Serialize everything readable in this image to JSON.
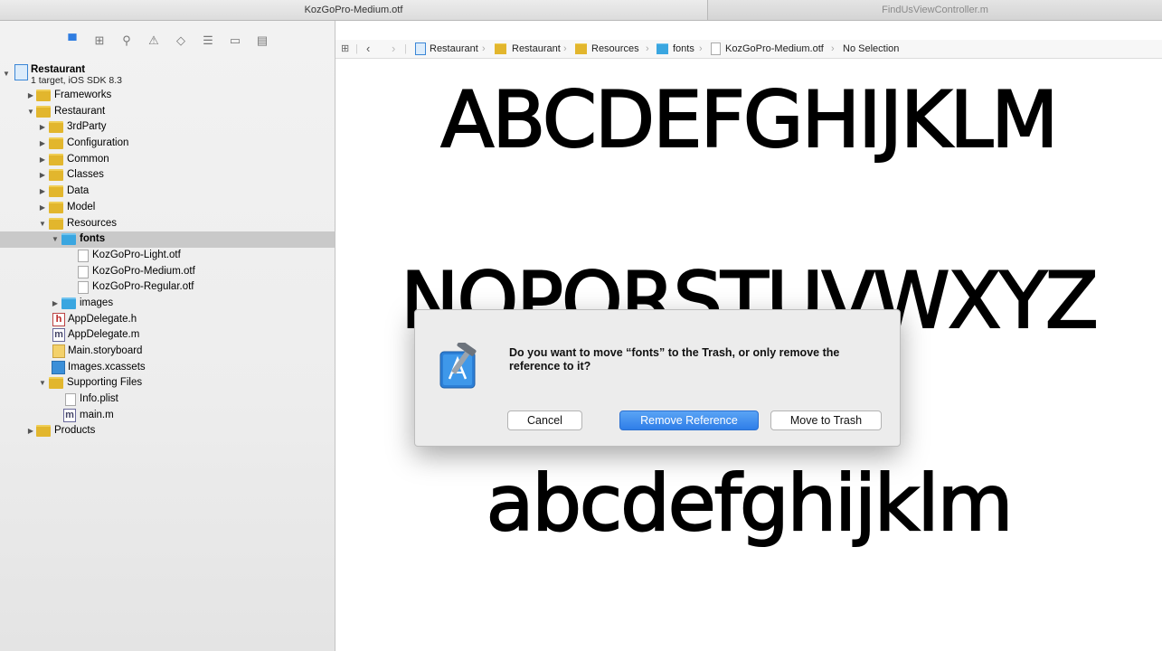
{
  "tabs": {
    "active": "KozGoPro-Medium.otf",
    "inactive": "FindUsViewController.m"
  },
  "project": {
    "name": "Restaurant",
    "subtitle": "1 target, iOS SDK 8.3"
  },
  "tree": {
    "frameworks": "Frameworks",
    "restaurant": "Restaurant",
    "third_party": "3rdParty",
    "configuration": "Configuration",
    "common": "Common",
    "classes": "Classes",
    "data": "Data",
    "model": "Model",
    "resources": "Resources",
    "fonts": "fonts",
    "font_light": "KozGoPro-Light.otf",
    "font_medium": "KozGoPro-Medium.otf",
    "font_regular": "KozGoPro-Regular.otf",
    "images": "images",
    "appdelegate_h": "AppDelegate.h",
    "appdelegate_m": "AppDelegate.m",
    "storyboard": "Main.storyboard",
    "xcassets": "Images.xcassets",
    "supporting": "Supporting Files",
    "info_plist": "Info.plist",
    "main_m": "main.m",
    "products": "Products"
  },
  "jumpbar": {
    "crumbs": [
      "Restaurant",
      "Restaurant",
      "Resources",
      "fonts",
      "KozGoPro-Medium.otf",
      "No Selection"
    ]
  },
  "preview": {
    "uppercase1": "ABCDEFGHIJKLM",
    "uppercase2": "NOPQRSTUVWXYZ",
    "lowercase1": "abcdefghijklm"
  },
  "dialog": {
    "message": "Do you want to move “fonts” to the Trash, or only remove the reference to it?",
    "cancel": "Cancel",
    "remove_reference": "Remove Reference",
    "move_to_trash": "Move to Trash"
  },
  "colors": {
    "accent": "#2f7ee8",
    "folder": "#e2b62d",
    "folder_blue": "#3aa6e0"
  }
}
